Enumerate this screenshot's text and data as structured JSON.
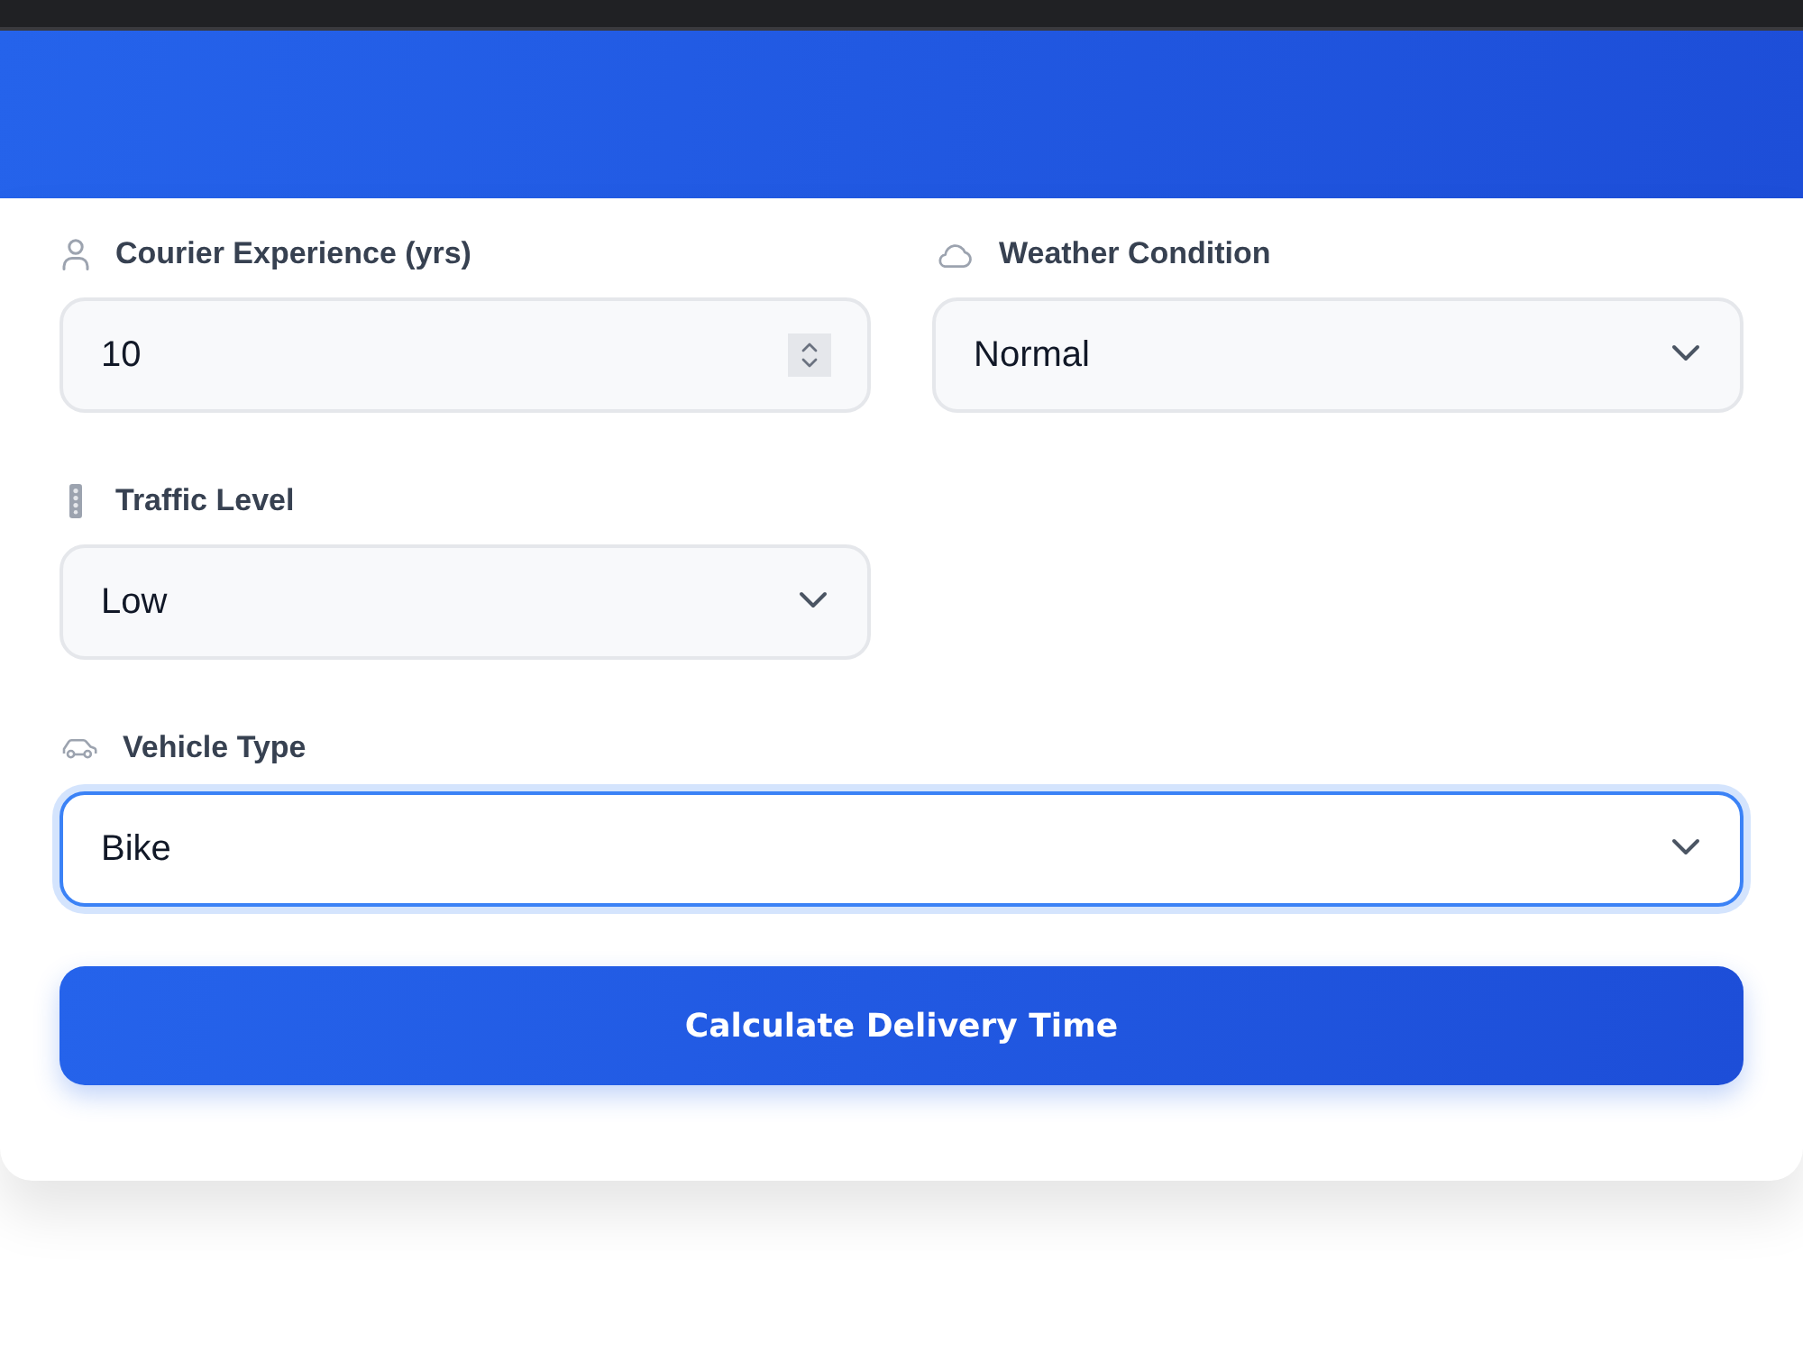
{
  "form": {
    "grid_fields": [
      {
        "kind": "number",
        "label": "Courier Experience (yrs)",
        "value": "10",
        "focused": false
      },
      {
        "kind": "select",
        "label": "Weather Condition",
        "value": "Normal",
        "focused": false
      },
      {
        "kind": "select",
        "label": "Traffic Level",
        "value": "Low",
        "focused": false
      }
    ],
    "wide_fields": [
      {
        "kind": "select",
        "label": "Vehicle Type",
        "value": "Bike",
        "focused": true
      }
    ],
    "submit_button": {
      "label": "Calculate Delivery Time"
    }
  }
}
